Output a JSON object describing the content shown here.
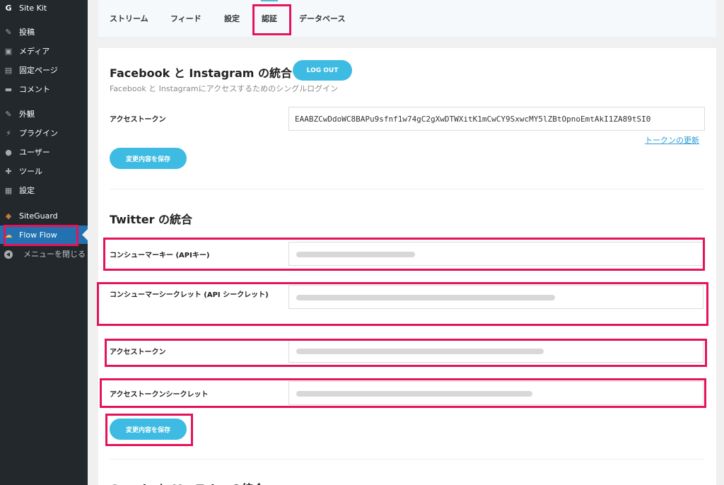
{
  "sidebar": {
    "items": [
      {
        "label": "Site Kit",
        "icon": "site-kit-g-icon",
        "glyph": "G"
      },
      {
        "label": "投稿",
        "icon": "pin-icon",
        "glyph": "✎"
      },
      {
        "label": "メディア",
        "icon": "media-icon",
        "glyph": "▣"
      },
      {
        "label": "固定ページ",
        "icon": "page-icon",
        "glyph": "▤"
      },
      {
        "label": "コメント",
        "icon": "comment-icon",
        "glyph": "▬"
      },
      {
        "label": "外観",
        "icon": "appearance-brush-icon",
        "glyph": "✎"
      },
      {
        "label": "プラグイン",
        "icon": "plugin-icon",
        "glyph": "⚡"
      },
      {
        "label": "ユーザー",
        "icon": "user-icon",
        "glyph": "●"
      },
      {
        "label": "ツール",
        "icon": "wrench-icon",
        "glyph": "✚"
      },
      {
        "label": "設定",
        "icon": "settings-icon",
        "glyph": "▦"
      },
      {
        "label": "SiteGuard",
        "icon": "siteguard-icon",
        "glyph": "◆"
      },
      {
        "label": "Flow Flow",
        "icon": "flow-flow-cloud-icon",
        "glyph": "☁"
      }
    ],
    "collapse_label": "メニューを閉じる"
  },
  "tabs": [
    "ストリーム",
    "フィード",
    "設定",
    "認証",
    "データベース"
  ],
  "facebook": {
    "title": "Facebook と Instagram の統合",
    "logout_label": "LOG OUT",
    "subtitle": "Facebook と Instagramにアクセスするためのシングルログイン",
    "token_label": "アクセストークン",
    "token_value": "EAABZCwDdoWC8BAPu9sfnf1w74gC2gXwDTWXitK1mCwCY9SxwcMY5lZBtOpnoEmtAkI1ZA89tSI0",
    "refresh_label": "トークンの更新",
    "save_label": "変更内容を保存"
  },
  "twitter": {
    "title": "Twitter の統合",
    "consumer_key_label": "コンシューマーキー (APIキー)",
    "consumer_secret_label": "コンシューマーシークレット (API シークレット)",
    "access_token_label": "アクセストークン",
    "access_token_secret_label": "アクセストークンシークレット",
    "save_label": "変更内容を保存"
  },
  "next_section_title": "Google と YouTube の統合",
  "colors": {
    "accent": "#3ebbe2",
    "highlight": "#e4145a",
    "sidebar_bg": "#23282d",
    "sidebar_active": "#2271b1"
  }
}
